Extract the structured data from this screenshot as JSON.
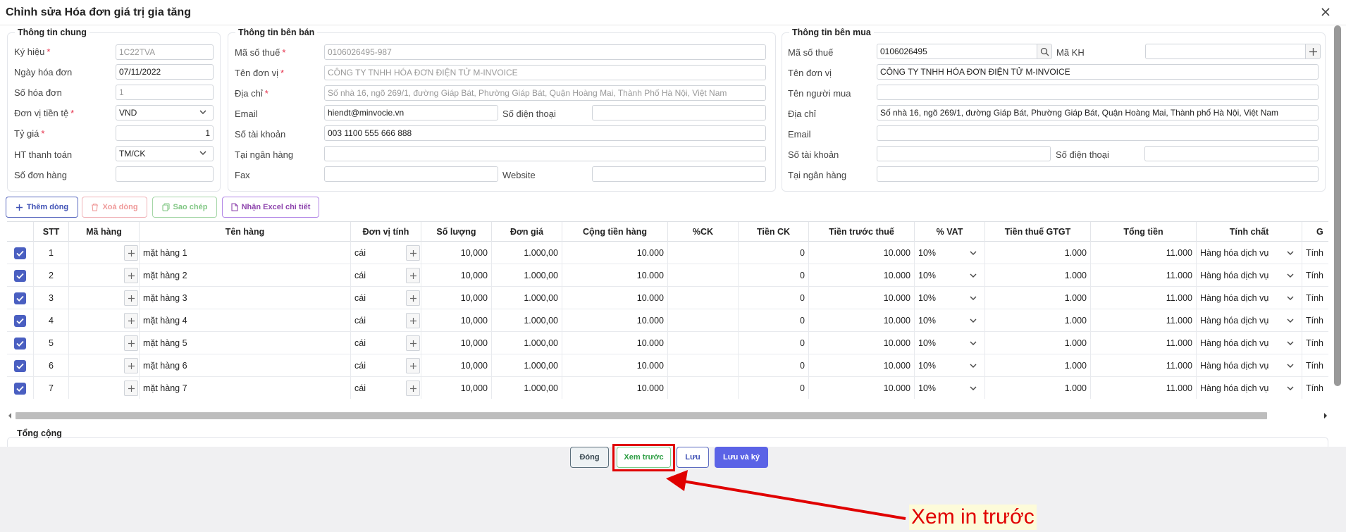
{
  "window": {
    "title": "Chỉnh sửa Hóa đơn giá trị gia tăng"
  },
  "general": {
    "legend": "Thông tin chung",
    "symbol_label": "Ký hiệu",
    "symbol_value": "1C22TVA",
    "date_label": "Ngày hóa đơn",
    "date_value": "07/11/2022",
    "number_label": "Số hóa đơn",
    "number_value": "1",
    "currency_label": "Đơn vị tiền tệ",
    "currency_value": "VND",
    "rate_label": "Tỷ giá",
    "rate_value": "1",
    "payment_label": "HT thanh toán",
    "payment_value": "TM/CK",
    "order_label": "Số đơn hàng",
    "order_value": ""
  },
  "seller": {
    "legend": "Thông tin bên bán",
    "tax_label": "Mã số thuế",
    "tax_value": "0106026495-987",
    "name_label": "Tên đơn vị",
    "name_value": "CÔNG TY TNHH HÓA ĐƠN ĐIỆN TỬ M-INVOICE",
    "address_label": "Địa chỉ",
    "address_value": "Số nhà 16, ngõ 269/1, đường Giáp Bát, Phường Giáp Bát, Quận Hoàng Mai, Thành Phố Hà Nội, Việt Nam",
    "email_label": "Email",
    "email_value": "hiendt@minvocie.vn",
    "phone_label": "Số điện thoại",
    "phone_value": "",
    "account_label": "Số tài khoản",
    "account_value": "003 1100 555 666 888",
    "bank_label": "Tại ngân hàng",
    "bank_value": "",
    "fax_label": "Fax",
    "fax_value": "",
    "website_label": "Website",
    "website_value": ""
  },
  "buyer": {
    "legend": "Thông tin bên mua",
    "tax_label": "Mã số thuế",
    "tax_value": "0106026495",
    "code_label": "Mã KH",
    "code_value": "",
    "name_label": "Tên đơn vị",
    "name_value": "CÔNG TY TNHH HÓA ĐƠN ĐIỆN TỬ M-INVOICE",
    "buyer_label": "Tên người mua",
    "buyer_value": "",
    "address_label": "Địa chỉ",
    "address_value": "Số nhà 16, ngõ 269/1, đường Giáp Bát, Phường Giáp Bát, Quận Hoàng Mai, Thành phố Hà Nội, Việt Nam",
    "email_label": "Email",
    "email_value": "",
    "account_label": "Số tài khoản",
    "account_value": "",
    "phone_label": "Số điện thoại",
    "phone_value": "",
    "bank_label": "Tại ngân hàng",
    "bank_value": ""
  },
  "toolbar": {
    "add_label": "Thêm dòng",
    "delete_label": "Xoá dòng",
    "copy_label": "Sao chép",
    "excel_label": "Nhận Excel chi tiết"
  },
  "table": {
    "columns": [
      "",
      "STT",
      "Mã hàng",
      "Tên hàng",
      "Đơn vị tính",
      "Số lượng",
      "Đơn giá",
      "Cộng tiền hàng",
      "%CK",
      "Tiền CK",
      "Tiền trước thuế",
      "% VAT",
      "Tiền thuế GTGT",
      "Tổng tiền",
      "Tính chất",
      "G"
    ],
    "rows": [
      {
        "stt": "1",
        "code": "",
        "name": "mặt hàng 1",
        "unit": "cái",
        "qty": "10,000",
        "price": "1.000,00",
        "amount": "10.000",
        "ck_pct": "",
        "ck": "0",
        "pretax": "10.000",
        "vat": "10%",
        "tax": "1.000",
        "total": "11.000",
        "nature": "Hàng hóa dịch vụ",
        "extra": "Tính"
      },
      {
        "stt": "2",
        "code": "",
        "name": "mặt hàng 2",
        "unit": "cái",
        "qty": "10,000",
        "price": "1.000,00",
        "amount": "10.000",
        "ck_pct": "",
        "ck": "0",
        "pretax": "10.000",
        "vat": "10%",
        "tax": "1.000",
        "total": "11.000",
        "nature": "Hàng hóa dịch vụ",
        "extra": "Tính"
      },
      {
        "stt": "3",
        "code": "",
        "name": "mặt hàng 3",
        "unit": "cái",
        "qty": "10,000",
        "price": "1.000,00",
        "amount": "10.000",
        "ck_pct": "",
        "ck": "0",
        "pretax": "10.000",
        "vat": "10%",
        "tax": "1.000",
        "total": "11.000",
        "nature": "Hàng hóa dịch vụ",
        "extra": "Tính"
      },
      {
        "stt": "4",
        "code": "",
        "name": "mặt hàng 4",
        "unit": "cái",
        "qty": "10,000",
        "price": "1.000,00",
        "amount": "10.000",
        "ck_pct": "",
        "ck": "0",
        "pretax": "10.000",
        "vat": "10%",
        "tax": "1.000",
        "total": "11.000",
        "nature": "Hàng hóa dịch vụ",
        "extra": "Tính"
      },
      {
        "stt": "5",
        "code": "",
        "name": "mặt hàng 5",
        "unit": "cái",
        "qty": "10,000",
        "price": "1.000,00",
        "amount": "10.000",
        "ck_pct": "",
        "ck": "0",
        "pretax": "10.000",
        "vat": "10%",
        "tax": "1.000",
        "total": "11.000",
        "nature": "Hàng hóa dịch vụ",
        "extra": "Tính"
      },
      {
        "stt": "6",
        "code": "",
        "name": "mặt hàng 6",
        "unit": "cái",
        "qty": "10,000",
        "price": "1.000,00",
        "amount": "10.000",
        "ck_pct": "",
        "ck": "0",
        "pretax": "10.000",
        "vat": "10%",
        "tax": "1.000",
        "total": "11.000",
        "nature": "Hàng hóa dịch vụ",
        "extra": "Tính"
      },
      {
        "stt": "7",
        "code": "",
        "name": "mặt hàng 7",
        "unit": "cái",
        "qty": "10,000",
        "price": "1.000,00",
        "amount": "10.000",
        "ck_pct": "",
        "ck": "0",
        "pretax": "10.000",
        "vat": "10%",
        "tax": "1.000",
        "total": "11.000",
        "nature": "Hàng hóa dịch vụ",
        "extra": "Tính"
      }
    ]
  },
  "total": {
    "legend": "Tổng cộng"
  },
  "footer": {
    "close_label": "Đóng",
    "preview_label": "Xem trước",
    "save_label": "Lưu",
    "save_sign_label": "Lưu và ký"
  },
  "annotation": {
    "text": "Xem in trước",
    "color": "#e00000"
  },
  "colors": {
    "accent": "#5b63e6",
    "checkbox": "#4a5fc1",
    "required": "#e5324c",
    "preview": "#2e9e44"
  }
}
